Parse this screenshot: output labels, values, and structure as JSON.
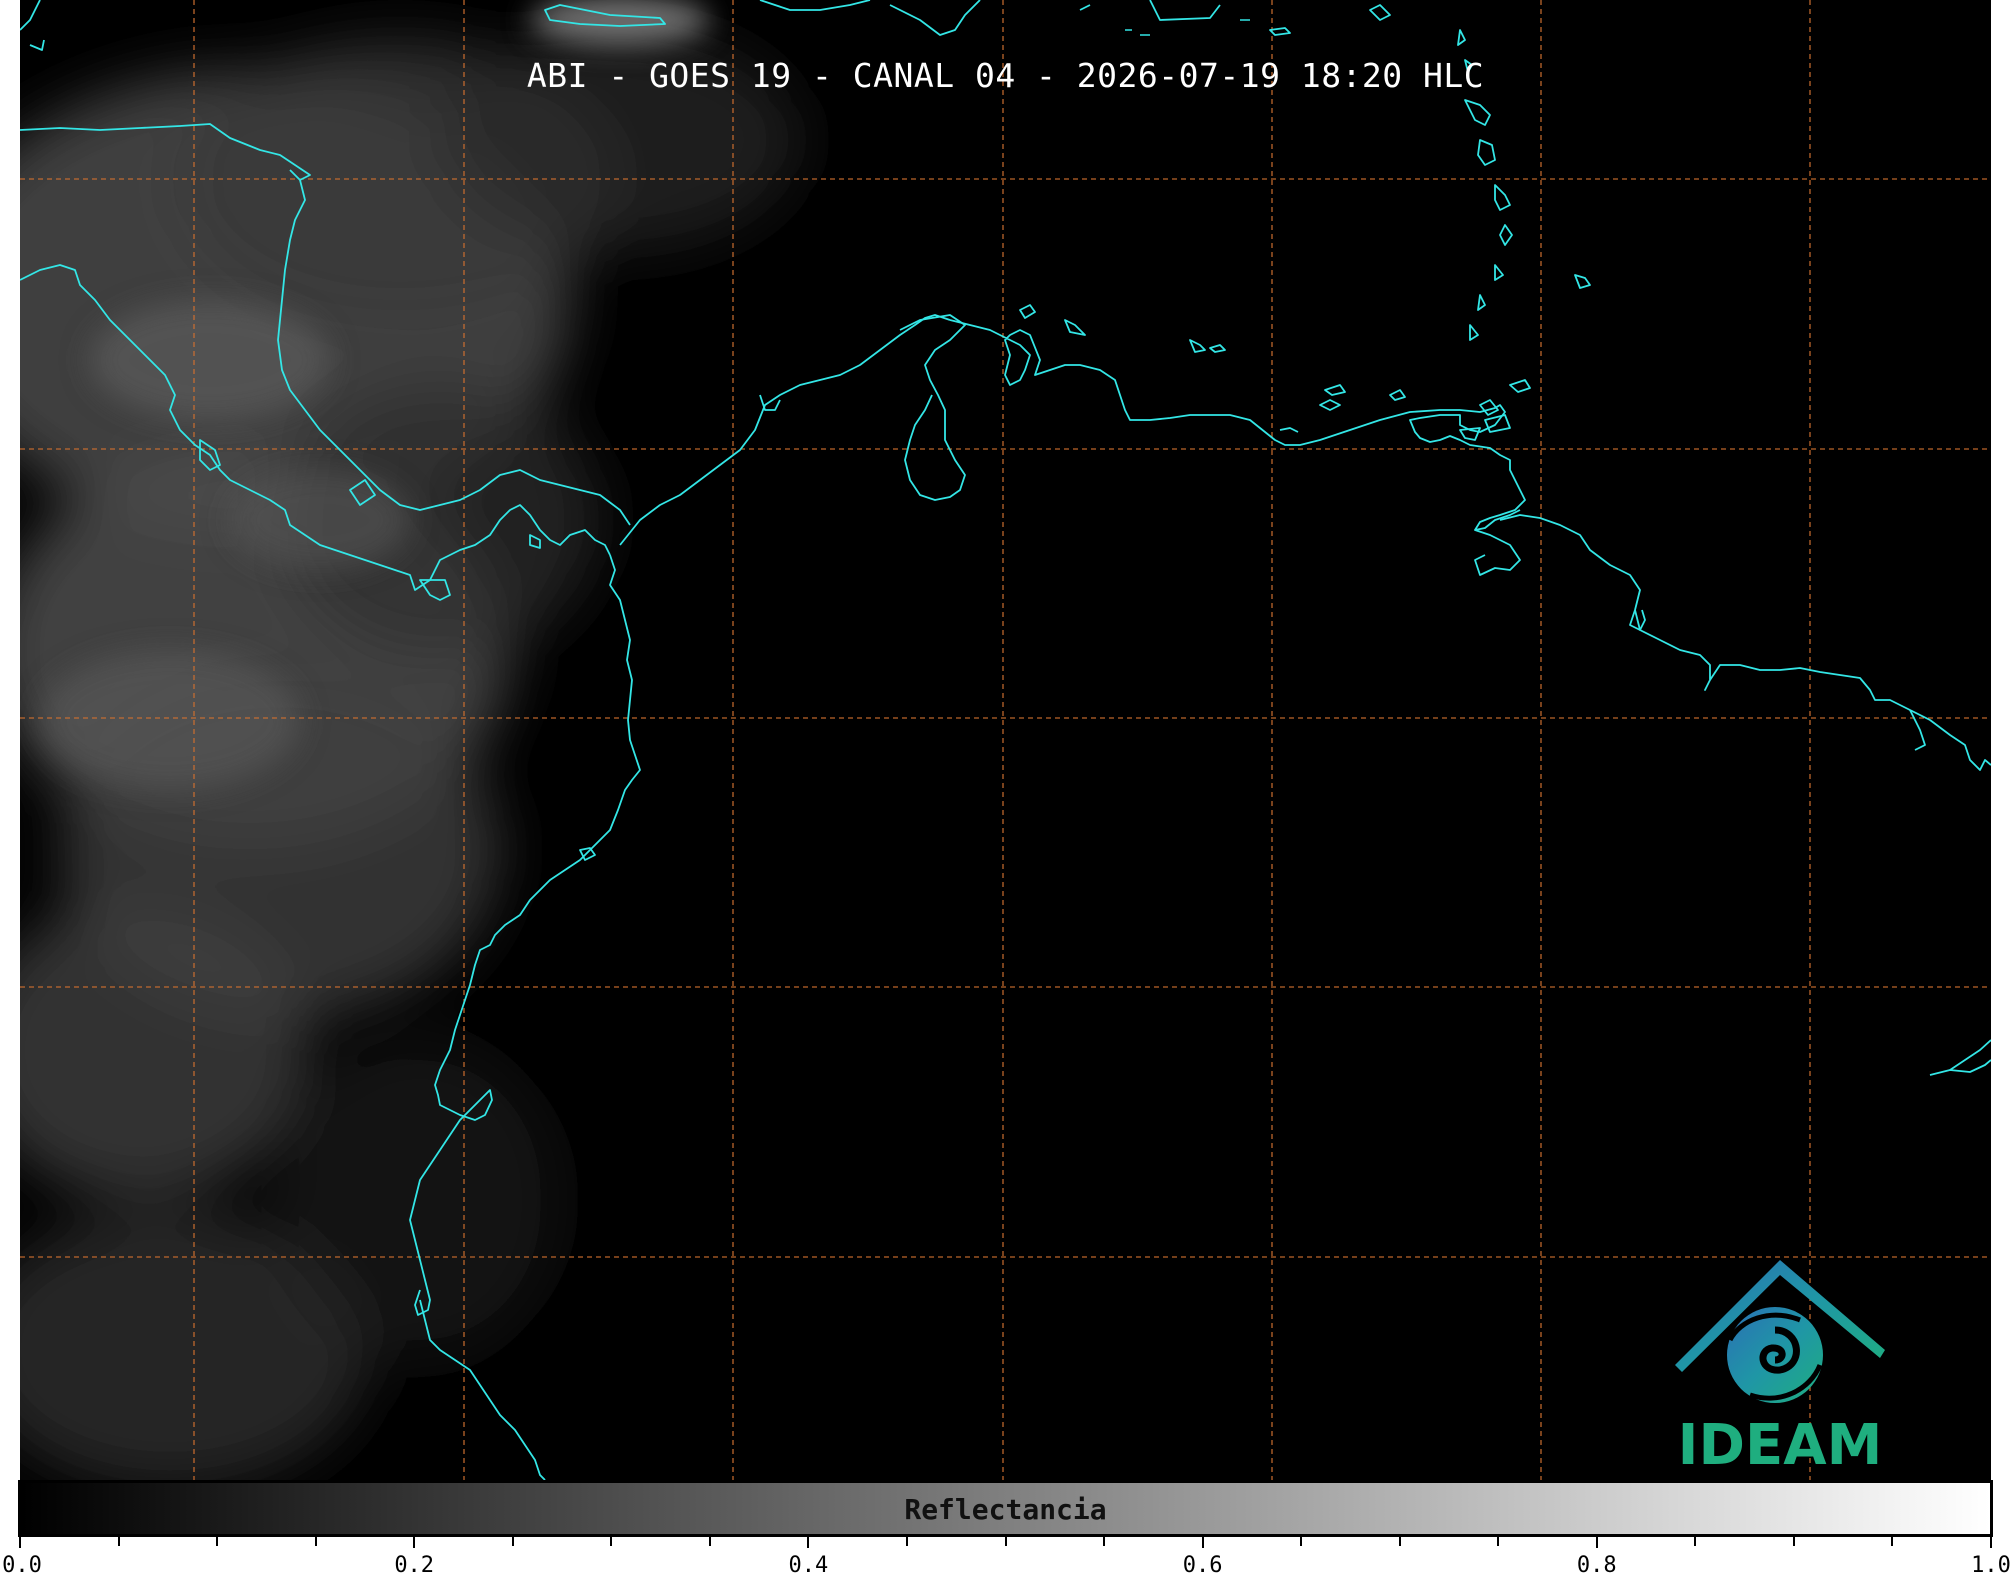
{
  "title": "ABI - GOES 19 - CANAL 04 - 2026-07-19 18:20 HLC",
  "logo": {
    "text": "IDEAM",
    "icon": "ideam-logo-icon"
  },
  "colorbar": {
    "label": "Reflectancia",
    "min": 0.0,
    "max": 1.0,
    "ticks": [
      "0.0",
      "0.2",
      "0.4",
      "0.6",
      "0.8",
      "1.0"
    ],
    "colors": {
      "start": "#000000",
      "end": "#ffffff"
    }
  },
  "map": {
    "background": "#000000",
    "coastline_color": "#33e6e6",
    "grid_color": "#d07030",
    "grid_style": "dashed"
  }
}
